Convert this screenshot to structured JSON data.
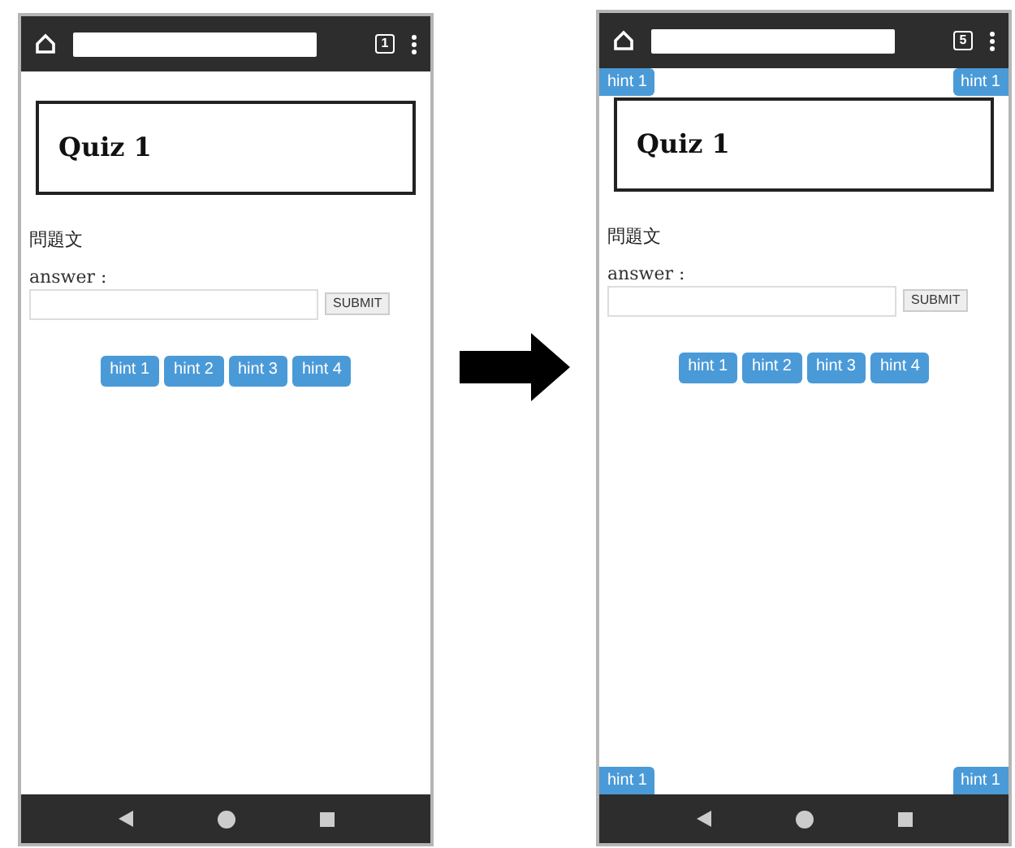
{
  "phones": [
    {
      "tab_count": "1",
      "title": "Quiz 1",
      "question": "問題文",
      "answer_label": "answer :",
      "submit": "SUBMIT",
      "hints": [
        "hint 1",
        "hint 2",
        "hint 3",
        "hint 4"
      ]
    },
    {
      "tab_count": "5",
      "title": "Quiz 1",
      "question": "問題文",
      "answer_label": "answer :",
      "submit": "SUBMIT",
      "hints": [
        "hint 1",
        "hint 2",
        "hint 3",
        "hint 4"
      ],
      "corner_hints": {
        "top": [
          "hint 1",
          "hint 1"
        ],
        "bottom": [
          "hint 1",
          "hint 1"
        ]
      }
    }
  ]
}
